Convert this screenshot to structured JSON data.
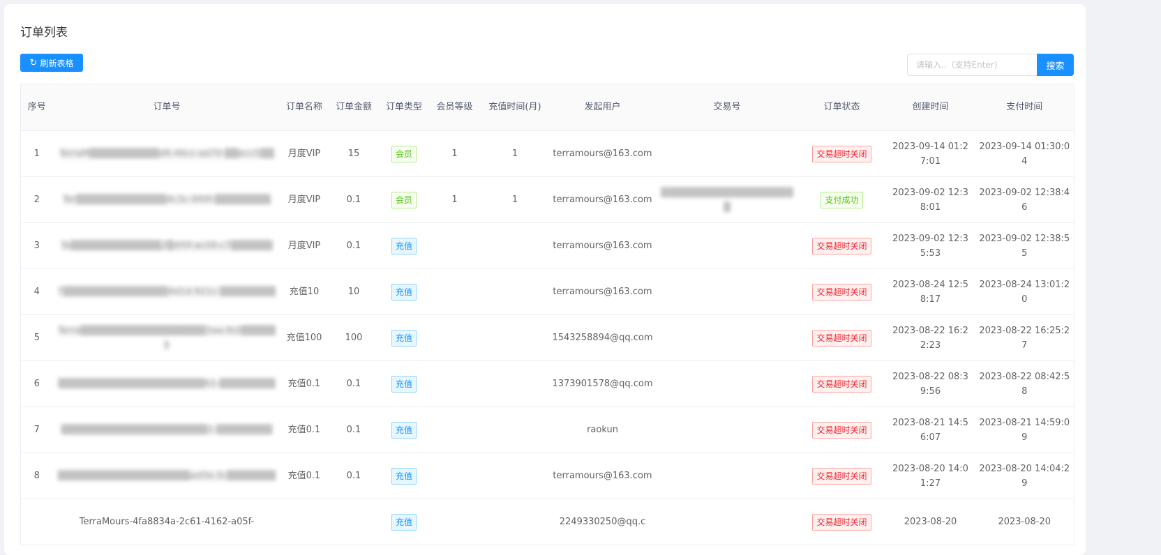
{
  "page": {
    "title": "订单列表"
  },
  "toolbar": {
    "refresh_label": "刷新表格",
    "search_placeholder": "请输入..（支持Enter)",
    "search_label": "搜索"
  },
  "table": {
    "headers": [
      "序号",
      "订单号",
      "订单名称",
      "订单金额",
      "订单类型",
      "会员等级",
      "充值时间(月)",
      "发起用户",
      "交易号",
      "订单状态",
      "创建时间",
      "支付时间"
    ],
    "rows": [
      {
        "seq": "1",
        "order_no": "TerraM▒▒▒▒▒▒▒▒▒▒d6-46cc-ad70-▒▒ecc5▒▒",
        "name": "月度VIP",
        "amount": "15",
        "type": "会员",
        "type_kind": "member",
        "level": "1",
        "months": "1",
        "user": "terramours@163.com",
        "trade_no": "",
        "status": "交易超时关闭",
        "status_kind": "closed",
        "created": "2023-09-14 01:27:01",
        "paid": "2023-09-14 01:30:04"
      },
      {
        "seq": "2",
        "order_no": "Ter▒▒▒▒▒▒▒▒▒▒▒▒▒4c3c-999f-▒▒▒▒▒▒▒▒",
        "name": "月度VIP",
        "amount": "0.1",
        "type": "会员",
        "type_kind": "member",
        "level": "1",
        "months": "1",
        "user": "terramours@163.com",
        "trade_no": "▒▒▒▒▒▒▒▒▒▒▒▒▒▒▒▒▒▒▒▒",
        "status": "支付成功",
        "status_kind": "ok",
        "created": "2023-09-02 12:38:01",
        "paid": "2023-09-02 12:38:46"
      },
      {
        "seq": "3",
        "order_no": "Te▒▒▒▒▒▒▒▒▒▒▒▒▒2▒4f0f-ac09-c7▒▒▒▒▒▒",
        "name": "月度VIP",
        "amount": "0.1",
        "type": "充值",
        "type_kind": "recharge",
        "level": "",
        "months": "",
        "user": "terramours@163.com",
        "trade_no": "",
        "status": "交易超时关闭",
        "status_kind": "closed",
        "created": "2023-09-02 12:35:53",
        "paid": "2023-09-02 12:38:55"
      },
      {
        "seq": "4",
        "order_no": "T▒▒▒▒▒▒▒▒▒▒▒▒▒▒▒4d1d-921c-▒▒▒▒▒▒▒▒",
        "name": "充值10",
        "amount": "10",
        "type": "充值",
        "type_kind": "recharge",
        "level": "",
        "months": "",
        "user": "terramours@163.com",
        "trade_no": "",
        "status": "交易超时关闭",
        "status_kind": "closed",
        "created": "2023-08-24 12:58:17",
        "paid": "2023-08-24 13:01:20"
      },
      {
        "seq": "5",
        "order_no": "Terra▒▒▒▒▒▒▒▒▒▒▒▒▒▒▒▒▒▒3aa-fb2▒▒▒▒▒0",
        "name": "充值100",
        "amount": "100",
        "type": "充值",
        "type_kind": "recharge",
        "level": "",
        "months": "",
        "user": "1543258894@qq.com",
        "trade_no": "",
        "status": "交易超时关闭",
        "status_kind": "closed",
        "created": "2023-08-22 16:22:23",
        "paid": "2023-08-22 16:25:27"
      },
      {
        "seq": "6",
        "order_no": "▒▒▒▒▒▒▒▒▒▒▒▒▒▒▒▒▒▒▒▒▒61-▒▒▒▒▒▒▒▒",
        "name": "充值0.1",
        "amount": "0.1",
        "type": "充值",
        "type_kind": "recharge",
        "level": "",
        "months": "",
        "user": "1373901578@qq.com",
        "trade_no": "",
        "status": "交易超时关闭",
        "status_kind": "closed",
        "created": "2023-08-22 08:39:56",
        "paid": "2023-08-22 08:42:58"
      },
      {
        "seq": "7",
        "order_no": "▒▒▒▒▒▒▒▒▒▒▒▒▒▒▒▒▒▒▒▒▒1-▒▒▒▒▒▒▒▒",
        "name": "充值0.1",
        "amount": "0.1",
        "type": "充值",
        "type_kind": "recharge",
        "level": "",
        "months": "",
        "user": "raokun",
        "trade_no": "",
        "status": "交易超时关闭",
        "status_kind": "closed",
        "created": "2023-08-21 14:56:07",
        "paid": "2023-08-21 14:59:09"
      },
      {
        "seq": "8",
        "order_no": "▒▒▒▒▒▒▒▒▒▒▒▒▒▒▒▒▒▒▒ad5b-3c▒▒▒▒▒▒▒",
        "name": "充值0.1",
        "amount": "0.1",
        "type": "充值",
        "type_kind": "recharge",
        "level": "",
        "months": "",
        "user": "terramours@163.com",
        "trade_no": "",
        "status": "交易超时关闭",
        "status_kind": "closed",
        "created": "2023-08-20 14:01:27",
        "paid": "2023-08-20 14:04:29"
      },
      {
        "seq": "",
        "order_no": "TerraMours-4fa8834a-2c61-4162-a05f-",
        "name": "",
        "amount": "",
        "type": "充值",
        "type_kind": "recharge",
        "level": "",
        "months": "",
        "user": "2249330250@qq.c",
        "trade_no": "",
        "status": "交易超时关闭",
        "status_kind": "closed",
        "created": "2023-08-20",
        "paid": "2023-08-20"
      }
    ]
  }
}
